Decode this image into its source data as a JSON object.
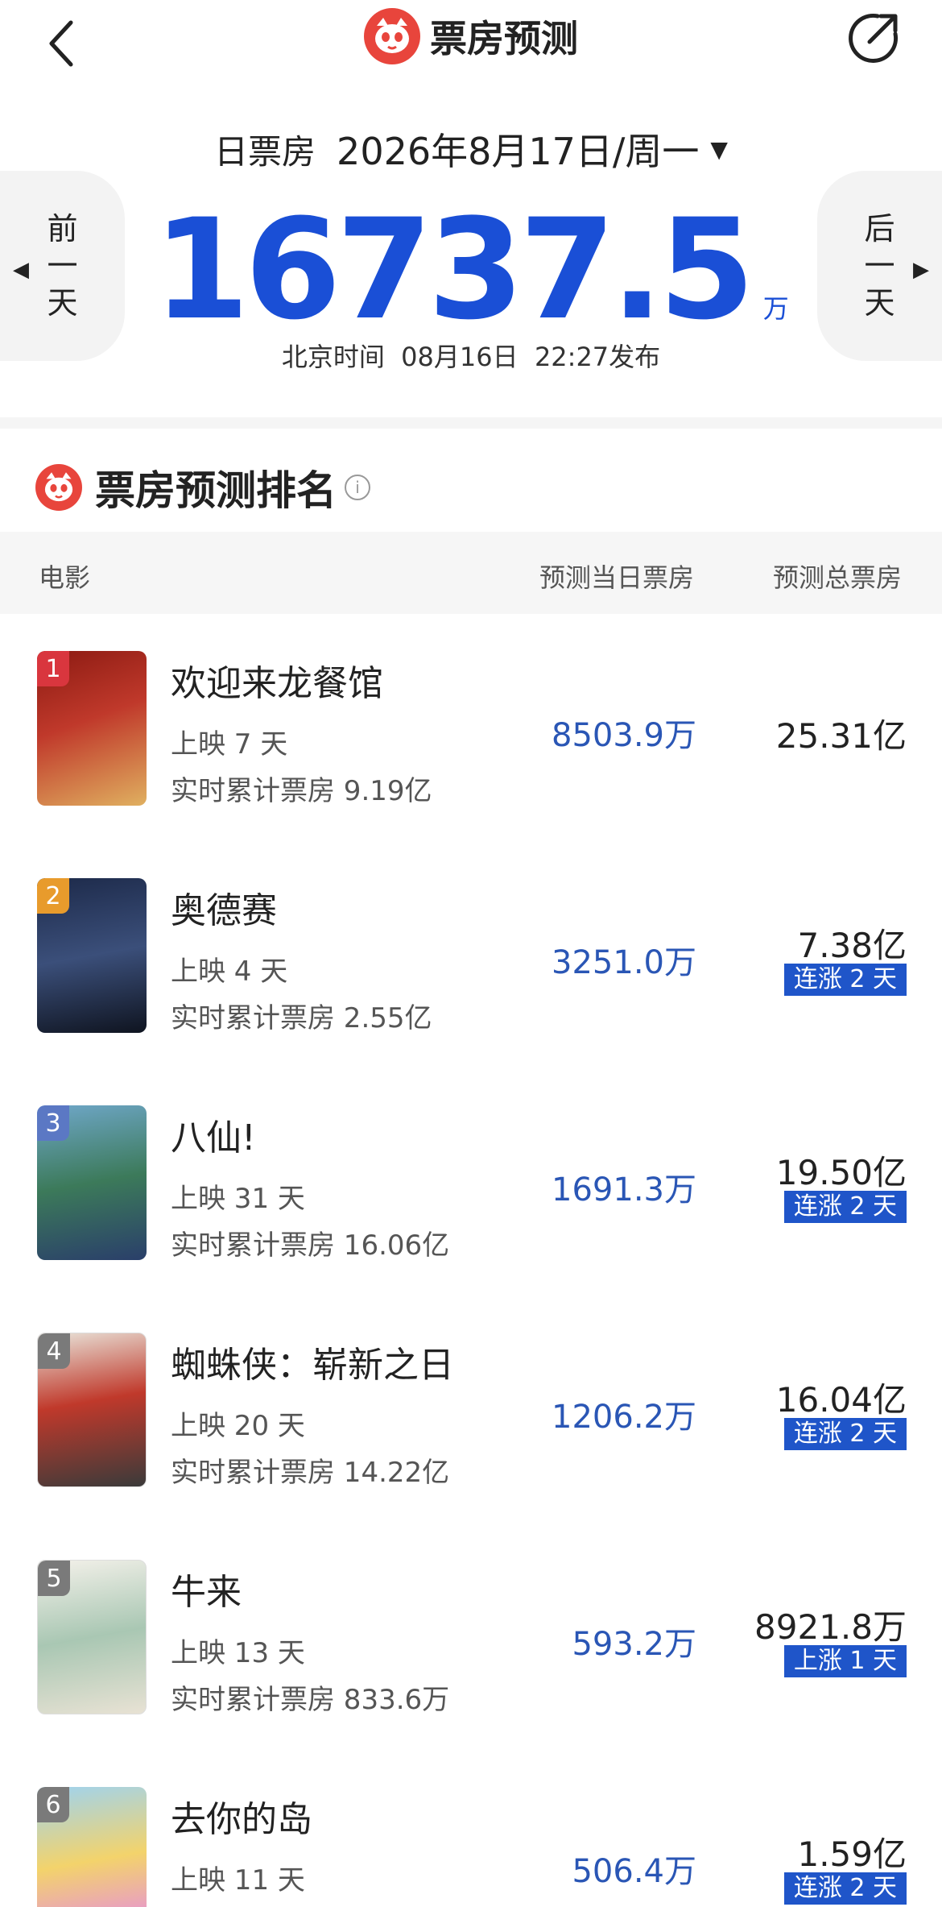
{
  "header": {
    "title": "票房预测"
  },
  "date": {
    "type_label": "日票房",
    "value": "2026年8月17日/周一"
  },
  "nav": {
    "prev": [
      "前",
      "一",
      "天"
    ],
    "next": [
      "后",
      "一",
      "天"
    ]
  },
  "summary": {
    "value": "16737.5",
    "unit": "万",
    "publish": "北京时间  08月16日  22:27发布"
  },
  "ranking": {
    "title": "票房预测排名",
    "columns": [
      "电影",
      "预测当日票房",
      "预测总票房"
    ]
  },
  "movies": [
    {
      "rank": "1",
      "name": "欢迎来龙餐馆",
      "days": "上映 7 天",
      "cumulative": "实时累计票房 9.19亿",
      "day_bo": "8503.9万",
      "total_bo": "25.31亿",
      "tag": ""
    },
    {
      "rank": "2",
      "name": "奥德赛",
      "days": "上映 4 天",
      "cumulative": "实时累计票房 2.55亿",
      "day_bo": "3251.0万",
      "total_bo": "7.38亿",
      "tag": "连涨 2 天"
    },
    {
      "rank": "3",
      "name": "八仙!",
      "days": "上映 31 天",
      "cumulative": "实时累计票房 16.06亿",
      "day_bo": "1691.3万",
      "total_bo": "19.50亿",
      "tag": "连涨 2 天"
    },
    {
      "rank": "4",
      "name": "蜘蛛侠：崭新之日",
      "days": "上映 20 天",
      "cumulative": "实时累计票房 14.22亿",
      "day_bo": "1206.2万",
      "total_bo": "16.04亿",
      "tag": "连涨 2 天"
    },
    {
      "rank": "5",
      "name": "牛来",
      "days": "上映 13 天",
      "cumulative": "实时累计票房 833.6万",
      "day_bo": "593.2万",
      "total_bo": "8921.8万",
      "tag": "上涨 1 天"
    },
    {
      "rank": "6",
      "name": "去你的岛",
      "days": "上映 11 天",
      "cumulative": "",
      "day_bo": "506.4万",
      "total_bo": "1.59亿",
      "tag": "连涨 2 天"
    }
  ],
  "colors": {
    "accent_blue": "#1a4fd6",
    "tag_blue": "#1f55c9",
    "brand_red": "#e8453c",
    "badge_colors": [
      "#d9363e",
      "#e89b2c",
      "#5b78c4",
      "#7a7a7a",
      "#7a7a7a",
      "#7a7a7a"
    ]
  }
}
